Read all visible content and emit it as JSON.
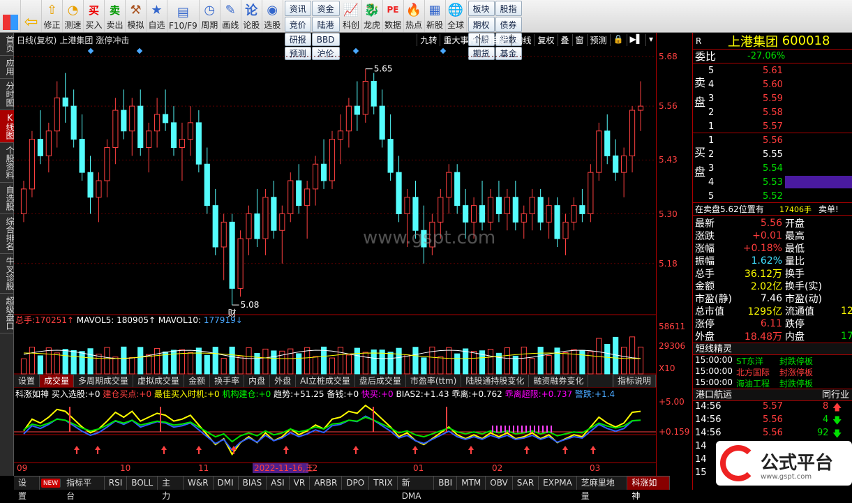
{
  "toolbar": {
    "buttons": [
      {
        "label": "",
        "icon": "windows-icon"
      },
      {
        "label": "",
        "icon": "back-arrow-icon"
      },
      {
        "label": "修正",
        "icon": "up-arrow-icon"
      },
      {
        "label": "测速",
        "icon": "timer-icon"
      },
      {
        "label": "买入",
        "icon": "buy-icon",
        "glyph": "买"
      },
      {
        "label": "卖出",
        "icon": "sell-icon",
        "glyph": "卖"
      },
      {
        "label": "模拟",
        "icon": "hammer-icon"
      },
      {
        "label": "自选",
        "icon": "star-icon"
      },
      {
        "label": "F10/F9",
        "icon": "f10-icon"
      },
      {
        "label": "周期",
        "icon": "clock-icon"
      },
      {
        "label": "画线",
        "icon": "pencil-icon"
      },
      {
        "label": "论股",
        "icon": "discuss-icon"
      },
      {
        "label": "选股",
        "icon": "select-stock-icon"
      }
    ],
    "grid1": [
      "资讯",
      "资金",
      "竞价",
      "陆港",
      "研报",
      "BBD",
      "预测",
      "沪伦"
    ],
    "buttons2": [
      {
        "label": "科创"
      },
      {
        "label": "龙虎"
      },
      {
        "label": "数据"
      },
      {
        "label": "热点"
      },
      {
        "label": "新股"
      },
      {
        "label": "全球"
      }
    ],
    "grid2": [
      "板块",
      "股指",
      "期权",
      "债券",
      "个股",
      "指数",
      "期货",
      "基金"
    ]
  },
  "leftnav": [
    "首页",
    "应用",
    "分时图",
    "K线图",
    "个股资料",
    "自选股",
    "综合排名",
    "牛叉诊股",
    "超级盘口"
  ],
  "chart_title": {
    "period": "日线(复权)",
    "name": "上港集团",
    "tag": "涨停冲击",
    "right_buttons": [
      "九转",
      "重大事件",
      "加自选",
      "均线",
      "复权",
      "叠",
      "窗",
      "预测"
    ]
  },
  "chart_data": {
    "type": "candlestick",
    "ylim": [
      5.06,
      5.7
    ],
    "yticks": [
      "5.68",
      "5.56",
      "5.43",
      "5.30",
      "5.18"
    ],
    "annotations": [
      {
        "label": "5.65"
      },
      {
        "label": "5.08"
      },
      {
        "label": "财"
      }
    ],
    "xticks": [
      "09",
      "10",
      "11",
      "2022-11-16,三",
      "12",
      "01",
      "02",
      "03"
    ],
    "candles": [
      [
        5.3,
        5.38,
        5.28,
        5.36
      ],
      [
        5.36,
        5.5,
        5.34,
        5.48
      ],
      [
        5.48,
        5.55,
        5.42,
        5.44
      ],
      [
        5.44,
        5.52,
        5.4,
        5.5
      ],
      [
        5.5,
        5.62,
        5.46,
        5.58
      ],
      [
        5.58,
        5.64,
        5.52,
        5.56
      ],
      [
        5.56,
        5.6,
        5.46,
        5.48
      ],
      [
        5.48,
        5.54,
        5.38,
        5.4
      ],
      [
        5.4,
        5.44,
        5.3,
        5.34
      ],
      [
        5.34,
        5.4,
        5.28,
        5.38
      ],
      [
        5.38,
        5.48,
        5.34,
        5.46
      ],
      [
        5.46,
        5.58,
        5.42,
        5.55
      ],
      [
        5.55,
        5.6,
        5.48,
        5.5
      ],
      [
        5.5,
        5.58,
        5.44,
        5.56
      ],
      [
        5.56,
        5.6,
        5.44,
        5.46
      ],
      [
        5.46,
        5.52,
        5.4,
        5.5
      ],
      [
        5.5,
        5.58,
        5.46,
        5.54
      ],
      [
        5.54,
        5.6,
        5.5,
        5.52
      ],
      [
        5.52,
        5.56,
        5.44,
        5.46
      ],
      [
        5.46,
        5.52,
        5.38,
        5.48
      ],
      [
        5.48,
        5.56,
        5.44,
        5.52
      ],
      [
        5.52,
        5.55,
        5.4,
        5.42
      ],
      [
        5.42,
        5.46,
        5.3,
        5.32
      ],
      [
        5.32,
        5.36,
        5.2,
        5.22
      ],
      [
        5.22,
        5.3,
        5.14,
        5.28
      ],
      [
        5.28,
        5.3,
        5.08,
        5.12
      ],
      [
        5.12,
        5.26,
        5.1,
        5.24
      ],
      [
        5.24,
        5.32,
        5.2,
        5.3
      ],
      [
        5.3,
        5.36,
        5.22,
        5.24
      ],
      [
        5.24,
        5.36,
        5.2,
        5.34
      ],
      [
        5.34,
        5.38,
        5.24,
        5.26
      ],
      [
        5.26,
        5.32,
        5.18,
        5.3
      ],
      [
        5.3,
        5.4,
        5.28,
        5.38
      ],
      [
        5.38,
        5.42,
        5.3,
        5.32
      ],
      [
        5.32,
        5.38,
        5.24,
        5.36
      ],
      [
        5.36,
        5.44,
        5.32,
        5.42
      ],
      [
        5.42,
        5.48,
        5.36,
        5.38
      ],
      [
        5.38,
        5.5,
        5.36,
        5.48
      ],
      [
        5.48,
        5.54,
        5.42,
        5.5
      ],
      [
        5.5,
        5.58,
        5.46,
        5.56
      ],
      [
        5.56,
        5.62,
        5.5,
        5.54
      ],
      [
        5.54,
        5.65,
        5.52,
        5.62
      ],
      [
        5.62,
        5.64,
        5.54,
        5.56
      ],
      [
        5.56,
        5.6,
        5.46,
        5.48
      ],
      [
        5.48,
        5.54,
        5.38,
        5.4
      ],
      [
        5.4,
        5.44,
        5.28,
        5.3
      ],
      [
        5.3,
        5.36,
        5.22,
        5.34
      ],
      [
        5.34,
        5.38,
        5.24,
        5.26
      ],
      [
        5.26,
        5.32,
        5.18,
        5.22
      ],
      [
        5.22,
        5.3,
        5.2,
        5.28
      ],
      [
        5.28,
        5.36,
        5.24,
        5.34
      ],
      [
        5.34,
        5.42,
        5.3,
        5.4
      ],
      [
        5.4,
        5.42,
        5.3,
        5.32
      ],
      [
        5.32,
        5.36,
        5.24,
        5.28
      ],
      [
        5.28,
        5.34,
        5.24,
        5.32
      ],
      [
        5.32,
        5.38,
        5.26,
        5.28
      ],
      [
        5.28,
        5.36,
        5.26,
        5.34
      ],
      [
        5.34,
        5.38,
        5.28,
        5.3
      ],
      [
        5.3,
        5.36,
        5.26,
        5.34
      ],
      [
        5.34,
        5.38,
        5.26,
        5.28
      ],
      [
        5.28,
        5.32,
        5.24,
        5.3
      ],
      [
        5.3,
        5.36,
        5.26,
        5.34
      ],
      [
        5.34,
        5.36,
        5.26,
        5.28
      ],
      [
        5.28,
        5.34,
        5.24,
        5.32
      ],
      [
        5.32,
        5.34,
        5.22,
        5.24
      ],
      [
        5.24,
        5.3,
        5.2,
        5.28
      ],
      [
        5.28,
        5.34,
        5.26,
        5.32
      ],
      [
        5.32,
        5.36,
        5.28,
        5.3
      ],
      [
        5.3,
        5.42,
        5.28,
        5.4
      ],
      [
        5.4,
        5.52,
        5.38,
        5.5
      ],
      [
        5.5,
        5.54,
        5.42,
        5.44
      ],
      [
        5.44,
        5.48,
        5.38,
        5.4
      ],
      [
        5.4,
        5.46,
        5.34,
        5.44
      ],
      [
        5.44,
        5.56,
        5.4,
        5.55
      ],
      [
        5.55,
        5.62,
        5.5,
        5.56
      ]
    ]
  },
  "volume": {
    "label_total": "总手:",
    "total": "170251",
    "label_ma5": "MAVOL5:",
    "ma5": "180905",
    "label_ma10": "MAVOL10:",
    "ma10": "177919",
    "yticks": [
      "58611",
      "29306",
      "X10"
    ]
  },
  "vol_tabs": [
    "设置",
    "成交量",
    "多周期成交量",
    "虚拟成交量",
    "金额",
    "换手率",
    "内盘",
    "外盘",
    "AI立桩成交量",
    "盘后成交量",
    "市盈率(ttm)",
    "陆股通持股变化",
    "融资融券变化"
  ],
  "vol_explain": "指标说明",
  "indicator": {
    "name": "科涨如神",
    "items": [
      {
        "label": "买入选股:",
        "value": "+0"
      },
      {
        "label": "建仓买点:",
        "value": "+0"
      },
      {
        "label": "最佳买入时机:",
        "value": "+0"
      },
      {
        "label": "机构建仓:",
        "value": "+0"
      },
      {
        "label": "趋势:",
        "value": "+51.25"
      },
      {
        "label": "备钱:",
        "value": "+0"
      },
      {
        "label": "快买:",
        "value": "+0"
      },
      {
        "label": "BIAS2:",
        "value": "+1.43"
      },
      {
        "label": "乖离:",
        "value": "+0.762"
      },
      {
        "label": "乖离超限:",
        "value": "+0.737"
      },
      {
        "label": "警跌:",
        "value": "+1.4"
      }
    ],
    "yticks": [
      "+5.00",
      "+0.159"
    ]
  },
  "bottom_tabs": [
    "设置",
    "NEW",
    "指标平台",
    "RSI",
    "BOLL",
    "主力",
    "W&R",
    "DMI",
    "BIAS",
    "ASI",
    "VR",
    "ARBR",
    "DPO",
    "TRIX",
    "新DMA",
    "BBI",
    "MTM",
    "OBV",
    "SAR",
    "EXPMA",
    "芝麻里地量",
    "科涨如神"
  ],
  "right": {
    "r_label": "R",
    "stock_name": "上港集团",
    "stock_code": "600018",
    "weibi_label": "委比",
    "weibi": "-27.06%",
    "sell_word": "卖盘",
    "buy_word": "买盘",
    "sell": [
      {
        "lvl": "5",
        "price": "5.61"
      },
      {
        "lvl": "4",
        "price": "5.60"
      },
      {
        "lvl": "3",
        "price": "5.59"
      },
      {
        "lvl": "2",
        "price": "5.58"
      },
      {
        "lvl": "1",
        "price": "5.57"
      }
    ],
    "buy": [
      {
        "lvl": "1",
        "price": "5.56"
      },
      {
        "lvl": "2",
        "price": "5.55"
      },
      {
        "lvl": "3",
        "price": "5.54"
      },
      {
        "lvl": "4",
        "price": "5.53"
      },
      {
        "lvl": "5",
        "price": "5.52"
      }
    ],
    "notice": "在卖盘5.62位置有",
    "notice_qty": "17406手",
    "notice_tail": "卖单!",
    "quotes": [
      {
        "l": "最新",
        "v": "5.56",
        "l2": "开盘"
      },
      {
        "l": "涨跌",
        "v": "+0.01",
        "l2": "最高"
      },
      {
        "l": "涨幅",
        "v": "+0.18%",
        "l2": "最低"
      },
      {
        "l": "振幅",
        "v": "1.62%",
        "l2": "量比"
      },
      {
        "l": "总手",
        "v": "36.12万",
        "l2": "换手"
      },
      {
        "l": "金额",
        "v": "2.02亿",
        "l2": "换手(实)"
      },
      {
        "l": "市盈(静)",
        "v": "7.46",
        "l2": "市盈(动)"
      },
      {
        "l": "总市值",
        "v": "1295亿",
        "l2": "流通值",
        "v2": "12"
      },
      {
        "l": "涨停",
        "v": "6.11",
        "l2": "跌停"
      },
      {
        "l": "外盘",
        "v": "18.48万",
        "l2": "内盘",
        "v2": "17"
      }
    ],
    "short_title": "短线精灵",
    "short": [
      {
        "t": "15:00:00",
        "n": "ST东洋",
        "s": "封跌停板"
      },
      {
        "t": "15:00:00",
        "n": "北方国际",
        "s": "封涨停板"
      },
      {
        "t": "15:00:00",
        "n": "海油工程",
        "s": "封跌停板"
      }
    ],
    "port_title": "港口航运",
    "port_right": "同行业",
    "port": [
      {
        "t": "14:56",
        "p": "5.57",
        "q": "8"
      },
      {
        "t": "14:56",
        "p": "5.56",
        "q": "4"
      },
      {
        "t": "14:56",
        "p": "5.56",
        "q": "92"
      },
      {
        "t": "14",
        "p": "",
        "q": ""
      },
      {
        "t": "14",
        "p": "",
        "q": ""
      },
      {
        "t": "15",
        "p": "",
        "q": ""
      }
    ]
  },
  "watermark": "www.gspt.com",
  "logo": {
    "text": "公式平台",
    "url": "www.gspt.com"
  }
}
